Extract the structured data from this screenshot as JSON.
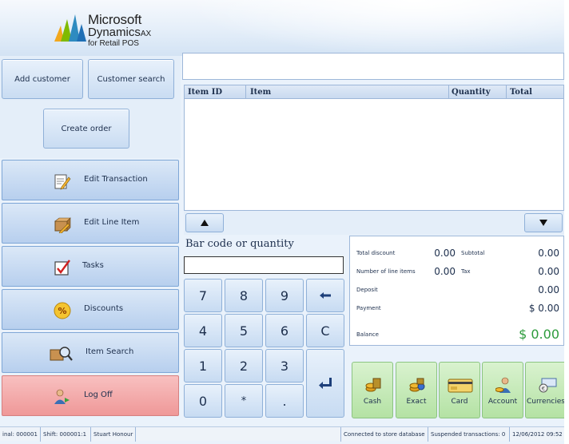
{
  "brand": {
    "line1": "Microsoft",
    "line2": "Dynamics",
    "line2_suffix": "AX",
    "line3": "for Retail POS",
    "colors": [
      "#f2a81d",
      "#7fba00",
      "#2e8bc0",
      "#1f6fb5"
    ]
  },
  "left_panel": {
    "add_customer": "Add customer",
    "customer_search": "Customer search",
    "create_order": "Create order",
    "nav": [
      {
        "label": "Edit Transaction",
        "icon": "edit-transaction-icon"
      },
      {
        "label": "Edit Line Item",
        "icon": "edit-line-item-icon"
      },
      {
        "label": "Tasks",
        "icon": "tasks-checkbox-icon"
      },
      {
        "label": "Discounts",
        "icon": "discount-percent-icon"
      },
      {
        "label": "Item Search",
        "icon": "item-search-icon"
      },
      {
        "label": "Log Off",
        "icon": "log-off-icon"
      }
    ]
  },
  "grid": {
    "columns": [
      "Item ID",
      "Item",
      "Quantity",
      "Total"
    ],
    "rows": []
  },
  "barcode": {
    "label": "Bar code or quantity",
    "value": ""
  },
  "keypad": {
    "k7": "7",
    "k8": "8",
    "k9": "9",
    "k4": "4",
    "k5": "5",
    "k6": "6",
    "k1": "1",
    "k2": "2",
    "k3": "3",
    "k0": "0",
    "kstar": "*",
    "kdot": ".",
    "clear": "C"
  },
  "totals": {
    "total_discount_label": "Total discount",
    "total_discount": "0.00",
    "subtotal_label": "Subtotal",
    "subtotal": "0.00",
    "line_items_label": "Number of line items",
    "line_items": "0.00",
    "tax_label": "Tax",
    "tax": "0.00",
    "deposit_label": "Deposit",
    "deposit": "0.00",
    "payment_label": "Payment",
    "payment": "$ 0.00",
    "balance_label": "Balance",
    "balance": "$ 0.00",
    "balance_color": "#2d9b3c"
  },
  "payments": [
    {
      "label": "Cash",
      "icon": "cash-coins-icon"
    },
    {
      "label": "Exact",
      "icon": "exact-coins-icon"
    },
    {
      "label": "Card",
      "icon": "card-icon"
    },
    {
      "label": "Account",
      "icon": "account-icon"
    },
    {
      "label": "Currencies",
      "icon": "currencies-icon"
    }
  ],
  "status_bar": {
    "terminal": "inal: 000001",
    "shift": "Shift: 000001:1",
    "operator": "Stuart Honour",
    "connection": "Connected to store database",
    "suspended": "Suspended transactions: 0",
    "datetime": "12/06/2012 09:52"
  }
}
